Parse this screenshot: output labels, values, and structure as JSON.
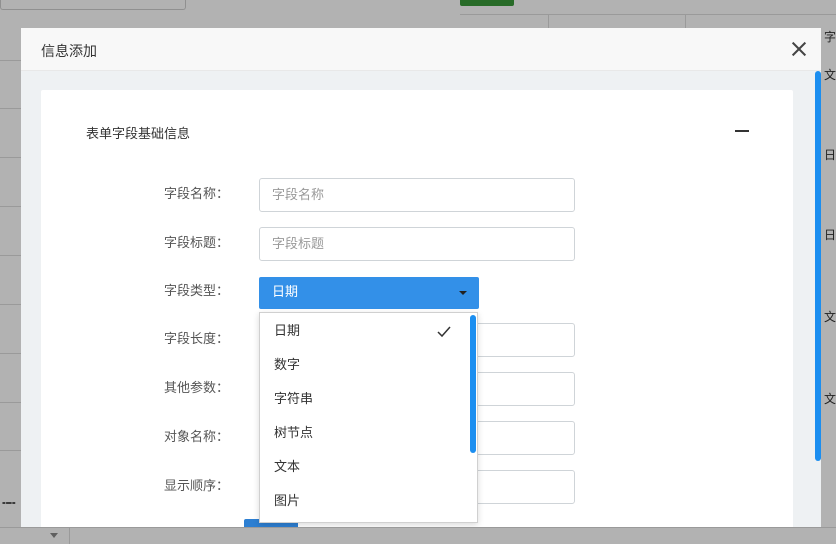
{
  "modal": {
    "title": "信息添加",
    "section_title": "表单字段基础信息"
  },
  "form": {
    "field_name": {
      "label": "字段名称：",
      "placeholder": "字段名称",
      "value": ""
    },
    "field_title": {
      "label": "字段标题：",
      "placeholder": "字段标题",
      "value": ""
    },
    "field_type": {
      "label": "字段类型：",
      "selected": "日期"
    },
    "field_length": {
      "label": "字段长度："
    },
    "other_params": {
      "label": "其他参数："
    },
    "object_name": {
      "label": "对象名称："
    },
    "display_order": {
      "label": "显示顺序："
    }
  },
  "dropdown": {
    "options": [
      "日期",
      "数字",
      "字符串",
      "树节点",
      "文本",
      "图片"
    ],
    "selected_index": 0
  },
  "background": {
    "right_column_chars": [
      "字",
      "文",
      "日",
      "日",
      "文",
      "文"
    ]
  },
  "colors": {
    "accent": "#1b8ef0",
    "select_bg": "#3390e8"
  },
  "icons": {
    "close": "close-icon",
    "collapse": "minus-icon",
    "caret": "caret-down-icon",
    "check": "check-icon"
  }
}
